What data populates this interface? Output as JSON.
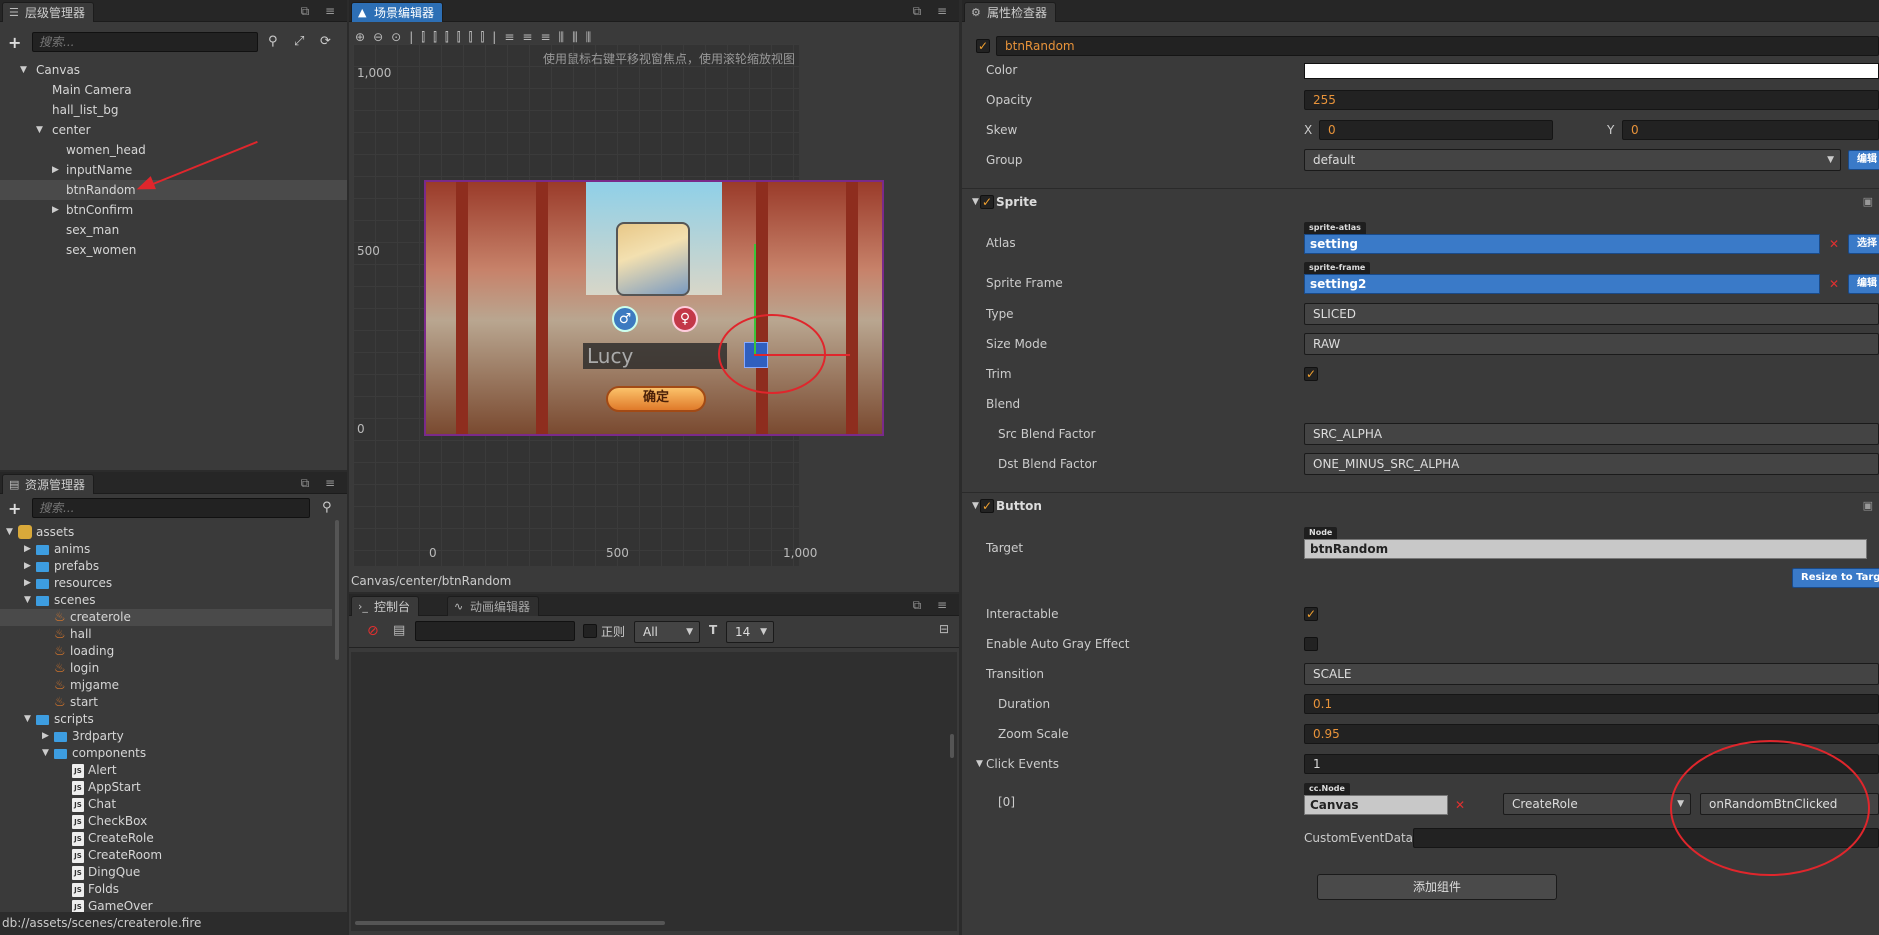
{
  "hierarchy": {
    "title": "层级管理器",
    "search_placeholder": "搜索...",
    "nodes": [
      {
        "label": "Canvas"
      },
      {
        "label": "Main Camera"
      },
      {
        "label": "hall_list_bg"
      },
      {
        "label": "center"
      },
      {
        "label": "women_head"
      },
      {
        "label": "inputName"
      },
      {
        "label": "btnRandom"
      },
      {
        "label": "btnConfirm"
      },
      {
        "label": "sex_man"
      },
      {
        "label": "sex_women"
      }
    ]
  },
  "assets": {
    "title": "资源管理器",
    "search_placeholder": "搜索...",
    "items": [
      {
        "label": "assets"
      },
      {
        "label": "anims"
      },
      {
        "label": "prefabs"
      },
      {
        "label": "resources"
      },
      {
        "label": "scenes"
      },
      {
        "label": "createrole"
      },
      {
        "label": "hall"
      },
      {
        "label": "loading"
      },
      {
        "label": "login"
      },
      {
        "label": "mjgame"
      },
      {
        "label": "start"
      },
      {
        "label": "scripts"
      },
      {
        "label": "3rdparty"
      },
      {
        "label": "components"
      },
      {
        "label": "Alert"
      },
      {
        "label": "AppStart"
      },
      {
        "label": "Chat"
      },
      {
        "label": "CheckBox"
      },
      {
        "label": "CreateRole"
      },
      {
        "label": "CreateRoom"
      },
      {
        "label": "DingQue"
      },
      {
        "label": "Folds"
      },
      {
        "label": "GameOver"
      }
    ],
    "status_path": "db://assets/scenes/createrole.fire"
  },
  "scene": {
    "title": "场景编辑器",
    "hint": "使用鼠标右键平移视窗焦点，使用滚轮缩放视图",
    "y_ticks": [
      "1,000",
      "500",
      "0"
    ],
    "x_ticks": [
      "0",
      "500",
      "1,000"
    ],
    "breadcrumb": "Canvas/center/btnRandom",
    "name_text": "Lucy",
    "confirm_text": "确定",
    "male_symbol": "♂",
    "female_symbol": "♀"
  },
  "console": {
    "tab_console": "控制台",
    "tab_anim": "动画编辑器",
    "regex_label": "正则",
    "filter_value": "All",
    "font_size_value": "14"
  },
  "inspector": {
    "title": "属性检查器",
    "node_name": "btnRandom",
    "color_label": "Color",
    "opacity_label": "Opacity",
    "opacity_value": "255",
    "skew_label": "Skew",
    "skew_x_label": "X",
    "skew_x": "0",
    "skew_y_label": "Y",
    "skew_y": "0",
    "group_label": "Group",
    "group_value": "default",
    "group_edit": "编辑",
    "sprite": {
      "title": "Sprite",
      "atlas_label": "Atlas",
      "atlas_tag": "sprite-atlas",
      "atlas_value": "setting",
      "atlas_btn": "选择",
      "frame_label": "Sprite Frame",
      "frame_tag": "sprite-frame",
      "frame_value": "setting2",
      "frame_btn": "编辑",
      "type_label": "Type",
      "type_value": "SLICED",
      "sizemode_label": "Size Mode",
      "sizemode_value": "RAW",
      "trim_label": "Trim",
      "blend_label": "Blend",
      "src_label": "Src Blend Factor",
      "src_value": "SRC_ALPHA",
      "dst_label": "Dst Blend Factor",
      "dst_value": "ONE_MINUS_SRC_ALPHA"
    },
    "button": {
      "title": "Button",
      "target_label": "Target",
      "target_tag": "Node",
      "target_value": "btnRandom",
      "resize_btn": "Resize to Target",
      "interactable_label": "Interactable",
      "autogray_label": "Enable Auto Gray Effect",
      "transition_label": "Transition",
      "transition_value": "SCALE",
      "duration_label": "Duration",
      "duration_value": "0.1",
      "zoom_label": "Zoom Scale",
      "zoom_value": "0.95",
      "events_label": "Click Events",
      "events_count": "1",
      "event_index": "[0]",
      "event_tag": "cc.Node",
      "event_node": "Canvas",
      "event_component": "CreateRole",
      "event_handler": "onRandomBtnClicked",
      "custom_label": "CustomEventData"
    },
    "add_component": "添加组件"
  },
  "colors": {
    "accent": "#2d6fb5",
    "annotation_red": "#e0262c",
    "value_orange": "#e8933a"
  }
}
